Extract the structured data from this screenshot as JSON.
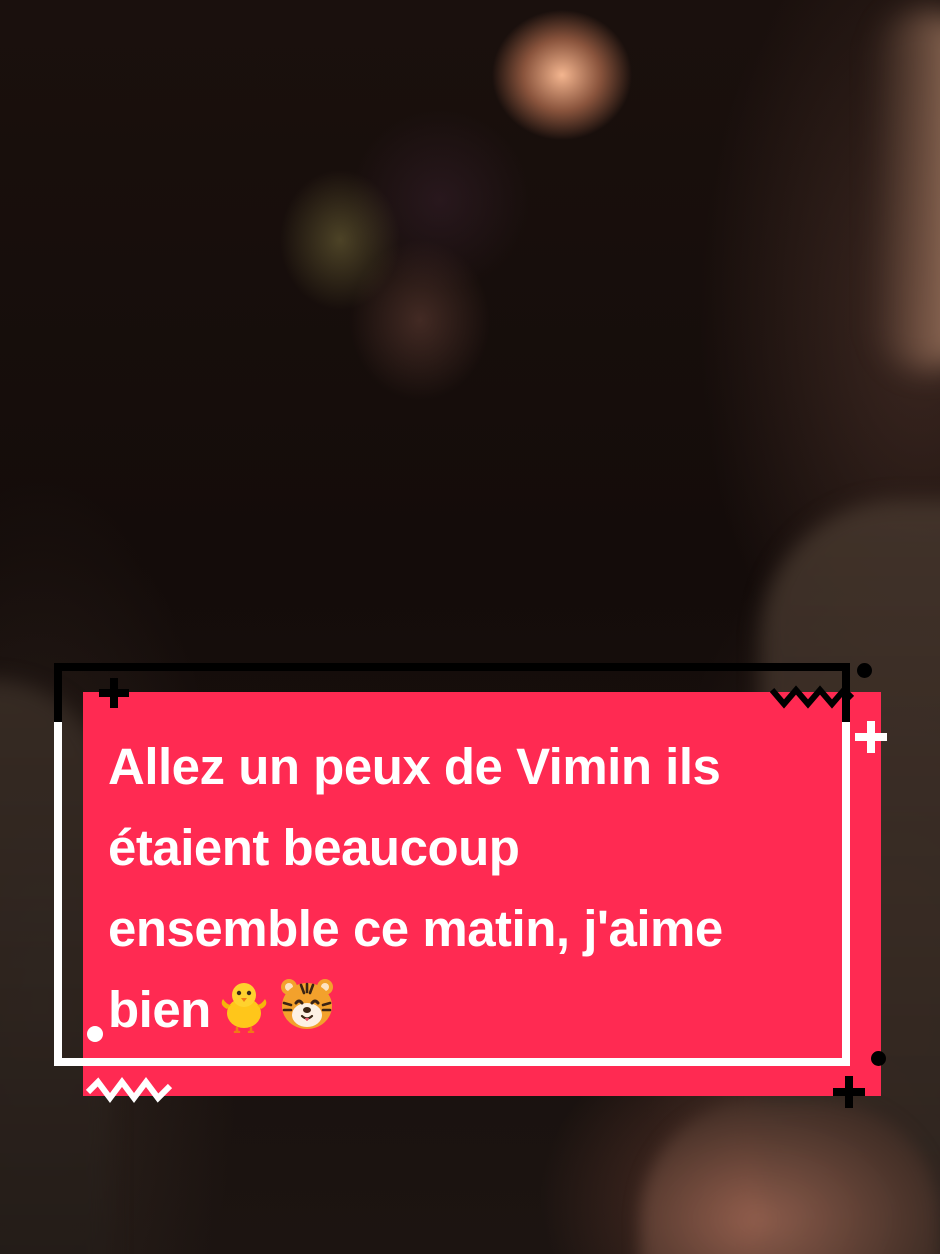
{
  "caption": {
    "lines": [
      "Allez un peux de Vimin ils",
      "étaient beaucoup",
      "ensemble ce matin, j'aime",
      "bien"
    ],
    "emojis": [
      "chick-emoji",
      "tiger-face-emoji"
    ],
    "colors": {
      "card": "#ff2a52",
      "text": "#ffffff",
      "frame_top": "#000000",
      "frame_bottom": "#ffffff"
    }
  },
  "decorations": [
    "plus-icon",
    "zigzag-icon",
    "dot-icon"
  ]
}
